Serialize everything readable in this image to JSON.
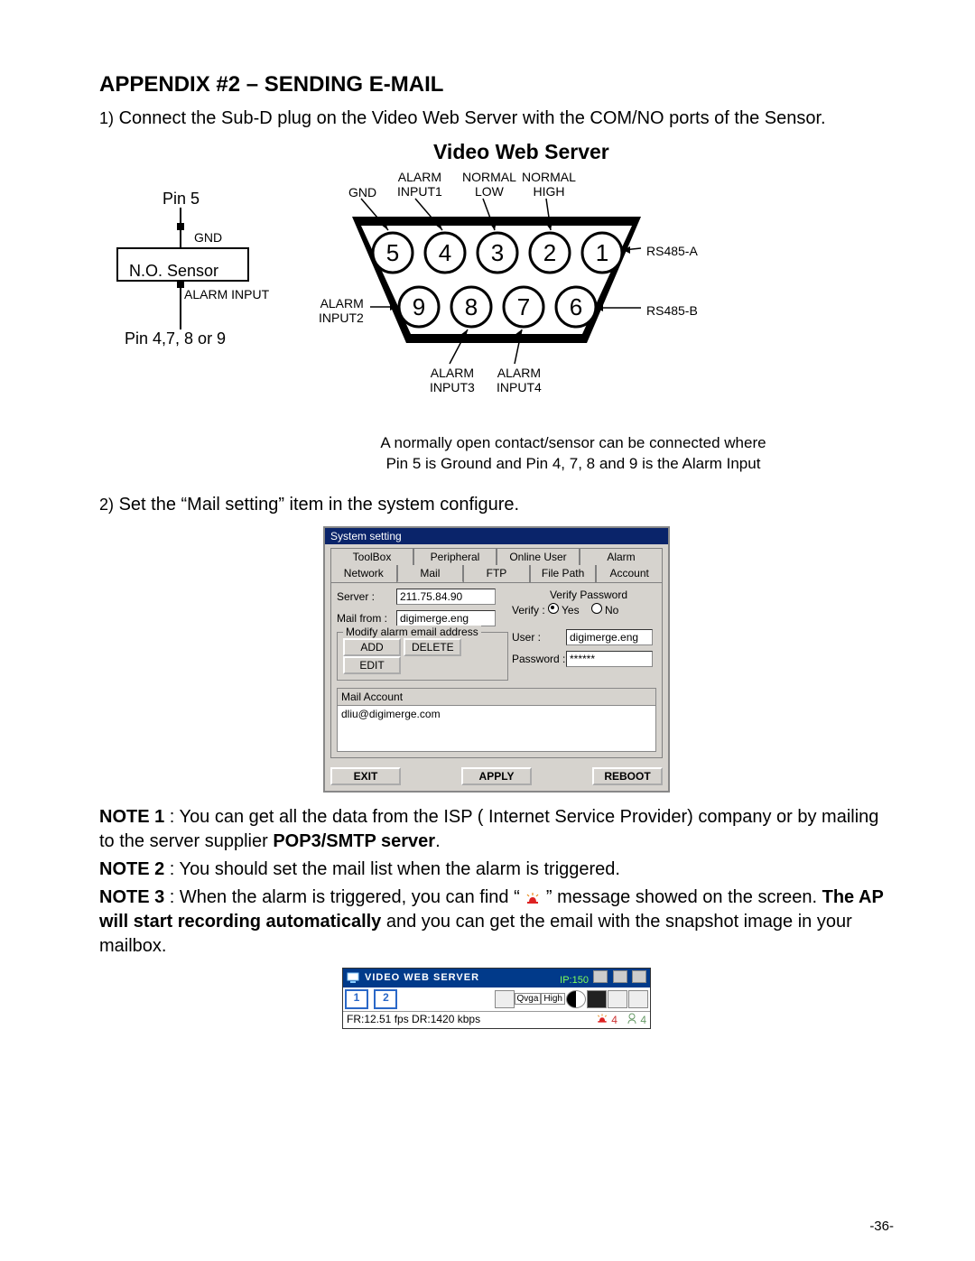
{
  "heading": "APPENDIX #2 – SENDING E-MAIL",
  "step1_num": "1)",
  "step1": "Connect the Sub-D plug on the Video Web Server with the COM/NO ports of the Sensor.",
  "fig1": {
    "title": "Video Web Server",
    "pin5": "Pin 5",
    "gnd": "GND",
    "no_sensor": "N.O. Sensor",
    "alarm_input": "ALARM INPUT",
    "pin4789": "Pin 4,7, 8 or 9",
    "top_gnd": "GND",
    "top_ai1": "ALARM\nINPUT1",
    "top_nlow": "NORMAL\nLOW",
    "top_nhigh": "NORMAL\nHIGH",
    "pins_top": [
      "5",
      "4",
      "3",
      "2",
      "1"
    ],
    "rs485a": "RS485-A",
    "left_ai2": "ALARM\nINPUT2",
    "pins_bot": [
      "9",
      "8",
      "7",
      "6"
    ],
    "rs485b": "RS485-B",
    "bot_ai3": "ALARM\nINPUT3",
    "bot_ai4": "ALARM\nINPUT4"
  },
  "caption_l1": "A normally open contact/sensor can be connected where",
  "caption_l2": "Pin 5 is Ground and Pin 4, 7, 8 and 9 is the Alarm Input",
  "step2_num": "2)",
  "step2": "Set the “Mail setting” item in the system configure.",
  "dlg": {
    "title": "System setting",
    "tabs_row1": [
      "ToolBox",
      "Peripheral",
      "Online User",
      "Alarm"
    ],
    "tabs_row2": [
      "Network",
      "Mail",
      "FTP",
      "File Path",
      "Account"
    ],
    "server_lbl": "Server :",
    "server_val": "211.75.84.90",
    "mailfrom_lbl": "Mail from :",
    "mailfrom_val": "digimerge.eng",
    "modify_legend": "Modify alarm email address",
    "btn_add": "ADD",
    "btn_del": "DELETE",
    "btn_edit": "EDIT",
    "verify_title": "Verify Password",
    "verify_lbl": "Verify :",
    "verify_yes": "Yes",
    "verify_no": "No",
    "user_lbl": "User :",
    "user_val": "digimerge.eng",
    "pwd_lbl": "Password :",
    "pwd_val": "******",
    "mailacct_head": "Mail Account",
    "mailacct_val": "dliu@digimerge.com",
    "btn_exit": "EXIT",
    "btn_apply": "APPLY",
    "btn_reboot": "REBOOT"
  },
  "notes": {
    "n1_lbl": "NOTE 1",
    "n1_a": " : You can get all the data from the ISP ( Internet Service Provider) company or by mailing to the server supplier ",
    "n1_b": "POP3/SMTP server",
    "n1_c": ".",
    "n2_lbl": "NOTE 2",
    "n2": " : You should set the mail list  when the alarm is triggered.",
    "n3_lbl": "NOTE 3",
    "n3_a": " : When the alarm is triggered, you can find “ ",
    "n3_b": " ” message showed on the screen. ",
    "n3_c": "The AP will start recording automatically",
    "n3_d": " and you can get the email with the snapshot image in your mailbox."
  },
  "vws": {
    "title": "VIDEO WEB SERVER",
    "ip": "IP:150",
    "ch1": "1",
    "ch2": "2",
    "qvga": "Qvga",
    "high": "High",
    "status": "FR:12.51 fps DR:1420 kbps",
    "alarm_cnt": "4",
    "user_cnt": "4"
  },
  "pagenum": "-36-"
}
